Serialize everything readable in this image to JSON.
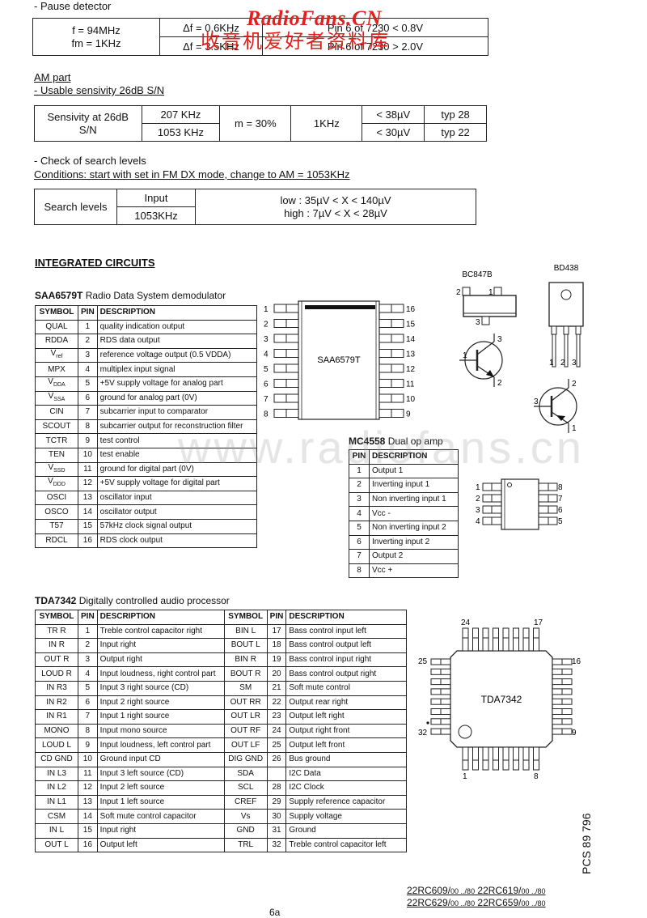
{
  "pause_detector": {
    "heading": "- Pause detector",
    "cond_line1": "f = 94MHz",
    "cond_line2": "fm = 1KHz",
    "rows": [
      {
        "df": "Δf = 0.6KHz",
        "result": "Pin 6 of 7230 < 0.8V"
      },
      {
        "df": "Δf = 3.5KHz",
        "result": "Pin 6 of 7230 > 2.0V"
      }
    ]
  },
  "am_part": {
    "heading": "AM part",
    "subheading": "- Usable sensivity 26dB S/N",
    "label_line1": "Sensivity at 26dB",
    "label_line2": "S/N",
    "modulation": "m = 30%",
    "fm": "1KHz",
    "rows": [
      {
        "freq": "207 KHz",
        "limit": "< 38µV",
        "typ": "typ 28"
      },
      {
        "freq": "1053 KHz",
        "limit": "< 30µV",
        "typ": "typ 22"
      }
    ]
  },
  "search_levels": {
    "heading": "- Check of search levels",
    "conditions": "Conditions: start with set in FM DX mode, change to AM = 1053KHz",
    "label": "Search levels",
    "input_label": "Input",
    "input_value": "1053KHz",
    "low": "low : 35µV < X < 140µV",
    "high": "high : 7µV < X < 28µV"
  },
  "ic_heading": "INTEGRATED CIRCUITS",
  "saa6579": {
    "name": "SAA6579T",
    "desc": " Radio Data System demodulator",
    "headers": [
      "SYMBOL",
      "PIN",
      "DESCRIPTION"
    ],
    "rows": [
      {
        "sym": "QUAL",
        "sub": "",
        "pin": "1",
        "desc": "quality indication output"
      },
      {
        "sym": "RDDA",
        "sub": "",
        "pin": "2",
        "desc": "RDS data output"
      },
      {
        "sym": "V",
        "sub": "ref",
        "pin": "3",
        "desc": "reference voltage output (0.5 VDDA)"
      },
      {
        "sym": "MPX",
        "sub": "",
        "pin": "4",
        "desc": "multiplex input signal"
      },
      {
        "sym": "V",
        "sub": "DDA",
        "pin": "5",
        "desc": "+5V supply voltage for analog part"
      },
      {
        "sym": "V",
        "sub": "SSA",
        "pin": "6",
        "desc": "ground for analog part (0V)"
      },
      {
        "sym": "CIN",
        "sub": "",
        "pin": "7",
        "desc": "subcarrier input to comparator"
      },
      {
        "sym": "SCOUT",
        "sub": "",
        "pin": "8",
        "desc": "subcarrier output for reconstruction filter"
      },
      {
        "sym": "TCTR",
        "sub": "",
        "pin": "9",
        "desc": "test control"
      },
      {
        "sym": "TEN",
        "sub": "",
        "pin": "10",
        "desc": "test enable"
      },
      {
        "sym": "V",
        "sub": "SSD",
        "pin": "11",
        "desc": "ground for digital part (0V)"
      },
      {
        "sym": "V",
        "sub": "DDD",
        "pin": "12",
        "desc": "+5V supply voltage for digital part"
      },
      {
        "sym": "OSCI",
        "sub": "",
        "pin": "13",
        "desc": "oscillator input"
      },
      {
        "sym": "OSCO",
        "sub": "",
        "pin": "14",
        "desc": "oscillator output"
      },
      {
        "sym": "T57",
        "sub": "",
        "pin": "15",
        "desc": "57kHz clock signal output"
      },
      {
        "sym": "RDCL",
        "sub": "",
        "pin": "16",
        "desc": "RDS clock output"
      }
    ],
    "chip_label": "SAA6579T",
    "left_pins": [
      "1",
      "2",
      "3",
      "4",
      "5",
      "6",
      "7",
      "8"
    ],
    "right_pins": [
      "16",
      "15",
      "14",
      "13",
      "12",
      "11",
      "10",
      "9"
    ]
  },
  "transistors": {
    "bc847b": {
      "name": "BC847B",
      "pins": {
        "p1": "1",
        "p2": "2",
        "p3": "3"
      }
    },
    "bd438": {
      "name": "BD438",
      "pins": {
        "p1": "1",
        "p2": "2",
        "p3": "3"
      }
    }
  },
  "mc4558": {
    "name": "MC4558",
    "desc": " Dual op amp",
    "headers": [
      "PIN",
      "DESCRIPTION"
    ],
    "rows": [
      {
        "pin": "1",
        "desc": "Output 1"
      },
      {
        "pin": "2",
        "desc": "Inverting input 1"
      },
      {
        "pin": "3",
        "desc": "Non inverting input 1"
      },
      {
        "pin": "4",
        "desc": "Vcc -"
      },
      {
        "pin": "5",
        "desc": "Non inverting input 2"
      },
      {
        "pin": "6",
        "desc": "Inverting input 2"
      },
      {
        "pin": "7",
        "desc": "Output 2"
      },
      {
        "pin": "8",
        "desc": "Vcc +"
      }
    ],
    "left_pins": [
      "1",
      "2",
      "3",
      "4"
    ],
    "right_pins": [
      "8",
      "7",
      "6",
      "5"
    ]
  },
  "tda7342": {
    "name": "TDA7342",
    "desc": " Digitally controlled audio processor",
    "headers": [
      "SYMBOL",
      "PIN",
      "DESCRIPTION",
      "SYMBOL",
      "PIN",
      "DESCRIPTION"
    ],
    "rows": [
      {
        "s1": "TR R",
        "p1": "1",
        "d1": "Treble control capacitor right",
        "s2": "BIN L",
        "p2": "17",
        "d2": "Bass control input left"
      },
      {
        "s1": "IN R",
        "p1": "2",
        "d1": "Input right",
        "s2": "BOUT L",
        "p2": "18",
        "d2": "Bass control output left"
      },
      {
        "s1": "OUT R",
        "p1": "3",
        "d1": "Output right",
        "s2": "BIN R",
        "p2": "19",
        "d2": "Bass control input right"
      },
      {
        "s1": "LOUD R",
        "p1": "4",
        "d1": "Input loudness, right control part",
        "s2": "BOUT R",
        "p2": "20",
        "d2": "Bass control output right"
      },
      {
        "s1": "IN R3",
        "p1": "5",
        "d1": "Input 3 right source (CD)",
        "s2": "SM",
        "p2": "21",
        "d2": "Soft mute control"
      },
      {
        "s1": "IN R2",
        "p1": "6",
        "d1": "Input 2 right source",
        "s2": "OUT RR",
        "p2": "22",
        "d2": "Output rear right"
      },
      {
        "s1": "IN R1",
        "p1": "7",
        "d1": "Input 1 right source",
        "s2": "OUT LR",
        "p2": "23",
        "d2": "Output left right"
      },
      {
        "s1": "MONO",
        "p1": "8",
        "d1": "Input mono source",
        "s2": "OUT RF",
        "p2": "24",
        "d2": "Output right front"
      },
      {
        "s1": "LOUD L",
        "p1": "9",
        "d1": "Input loudness, left control part",
        "s2": "OUT LF",
        "p2": "25",
        "d2": "Output left front"
      },
      {
        "s1": "CD GND",
        "p1": "10",
        "d1": "Ground input CD",
        "s2": "DIG GND",
        "p2": "26",
        "d2": "Bus ground"
      },
      {
        "s1": "IN L3",
        "p1": "11",
        "d1": "Input 3 left source (CD)",
        "s2": "SDA",
        "p2": "",
        "d2": "I2C Data"
      },
      {
        "s1": "IN L2",
        "p1": "12",
        "d1": "Input 2 left source",
        "s2": "SCL",
        "p2": "28",
        "d2": "I2C Clock"
      },
      {
        "s1": "IN L1",
        "p1": "13",
        "d1": "Input 1 left source",
        "s2": "CREF",
        "p2": "29",
        "d2": "Supply reference capacitor"
      },
      {
        "s1": "CSM",
        "p1": "14",
        "d1": "Soft mute control capacitor",
        "s2": "Vs",
        "p2": "30",
        "d2": "Supply voltage"
      },
      {
        "s1": "IN L",
        "p1": "15",
        "d1": "Input right",
        "s2": "GND",
        "p2": "31",
        "d2": "Ground"
      },
      {
        "s1": "OUT L",
        "p1": "16",
        "d1": "Output left",
        "s2": "TRL",
        "p2": "32",
        "d2": "Treble control capacitor left"
      }
    ],
    "chip_label": "TDA7342",
    "corner_pins": {
      "top_left": "24",
      "top_right": "17",
      "right_top": "16",
      "right_bottom": "9",
      "left_top": "25",
      "left_bottom": "32",
      "bottom_left": "1",
      "bottom_right": "8"
    }
  },
  "footer": {
    "models_line1_a": "22RC609/",
    "models_line1_a_small": "00 ../80",
    "models_line1_b": " 22RC619/",
    "models_line1_b_small": "00 ../80",
    "models_line2_a": "22RC629/",
    "models_line2_a_small": "00 ../80",
    "models_line2_b": " 22RC659/",
    "models_line2_b_small": "00 ../80",
    "page_number": "6a",
    "doc_code": "PCS 89 796"
  },
  "watermarks": {
    "red_latin": "RadioFans.CN",
    "red_chinese": "收音机爱好者资料库",
    "gray_url": "www.radiofans.cn"
  }
}
